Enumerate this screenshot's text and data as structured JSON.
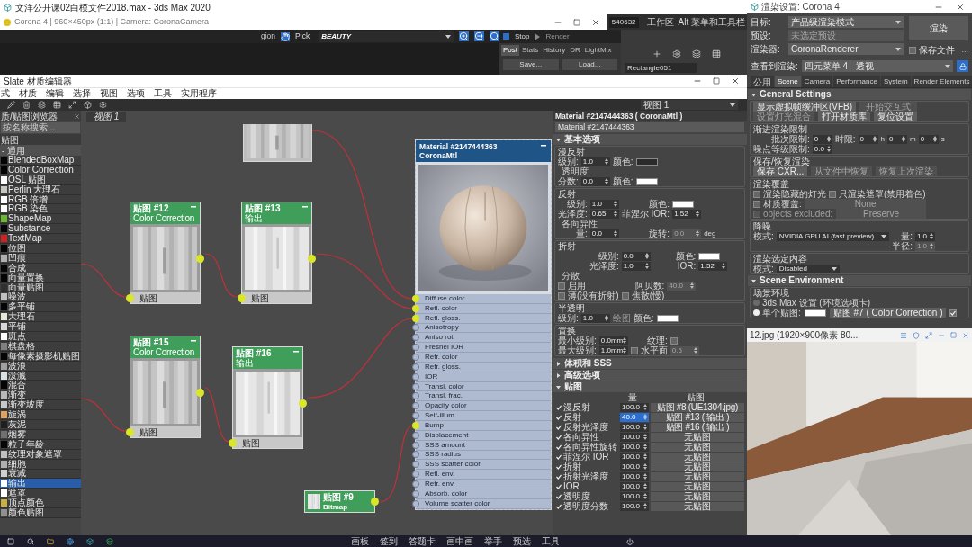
{
  "max_window": {
    "title": "文洋公开课02白模文件2018.max - 3ds Max 2020"
  },
  "vfb": {
    "title": "Corona 4 | 960×450px (1:1) | Camera: CoronaCamera",
    "region": "gion",
    "pick": "Pick",
    "channel": "BEAUTY",
    "stop": "Stop",
    "render": "Render",
    "tabs": [
      {
        "label": "Post",
        "selected": true
      },
      {
        "label": "Stats",
        "selected": false
      },
      {
        "label": "History",
        "selected": false
      },
      {
        "label": "DR",
        "selected": false
      },
      {
        "label": "LightMix",
        "selected": false
      }
    ],
    "buttons": [
      "Save...",
      "Load..."
    ]
  },
  "max_toolbar": {
    "value": "540632",
    "workspace": "工作区",
    "menu": "Alt 菜单和工具栏",
    "object": "Rectangle051"
  },
  "slate": {
    "title": "Slate 材质编辑器",
    "menu": [
      "式",
      "材质",
      "编辑",
      "选择",
      "视图",
      "选项",
      "工具",
      "实用程序"
    ],
    "view_dropdown": "视图 1",
    "view_tab": "视图 1",
    "browser": {
      "title": "质/贴图浏览器",
      "search": "按名称搜索...",
      "section": "贴图",
      "group": "- 通用",
      "items": [
        {
          "label": "BlendedBoxMap",
          "color": "#050505",
          "selected": false
        },
        {
          "label": "Color Correction",
          "color": "#050505",
          "selected": false
        },
        {
          "label": "OSL 贴图",
          "color": "#ffffff",
          "selected": false
        },
        {
          "label": "Perlin 大理石",
          "color": "#c8c8c0",
          "selected": false
        },
        {
          "label": "RGB 倍增",
          "color": "#ffffff",
          "selected": false
        },
        {
          "label": "RGB 染色",
          "color": "#ffffff",
          "selected": false
        },
        {
          "label": "ShapeMap",
          "color": "#6ab82e",
          "selected": false
        },
        {
          "label": "Substance",
          "color": "#050505",
          "selected": false
        },
        {
          "label": "TextMap",
          "color": "#d42020",
          "selected": false
        },
        {
          "label": "位图",
          "color": "#050505",
          "selected": false
        },
        {
          "label": "凹痕",
          "color": "#b0b0b0",
          "selected": false
        },
        {
          "label": "合成",
          "color": "#050505",
          "selected": false
        },
        {
          "label": "向量置换",
          "color": "#050505",
          "selected": false
        },
        {
          "label": "向量贴图",
          "color": "#303030",
          "selected": false
        },
        {
          "label": "噪波",
          "color": "#c0c0c0",
          "selected": false
        },
        {
          "label": "多平铺",
          "color": "#050505",
          "selected": false
        },
        {
          "label": "大理石",
          "color": "#e8e8d8",
          "selected": false
        },
        {
          "label": "平铺",
          "color": "#d8d8d8",
          "selected": false
        },
        {
          "label": "斑点",
          "color": "#ffffff",
          "selected": false
        },
        {
          "label": "棋盘格",
          "color": "#808080",
          "selected": false
        },
        {
          "label": "每像素摄影机贴图",
          "color": "#050505",
          "selected": false
        },
        {
          "label": "波浪",
          "color": "#a0a0a0",
          "selected": false
        },
        {
          "label": "泼溅",
          "color": "#d8e0e8",
          "selected": false
        },
        {
          "label": "混合",
          "color": "#050505",
          "selected": false
        },
        {
          "label": "渐变",
          "color": "#b8b8b8",
          "selected": false
        },
        {
          "label": "渐变坡度",
          "color": "#c8c8c8",
          "selected": false
        },
        {
          "label": "旋涡",
          "color": "#e0a060",
          "selected": false
        },
        {
          "label": "灰泥",
          "color": "#202020",
          "selected": false
        },
        {
          "label": "烟雾",
          "color": "#707070",
          "selected": false
        },
        {
          "label": "粒子年龄",
          "color": "#050505",
          "selected": false
        },
        {
          "label": "纹理对象遮罩",
          "color": "#c0c0c0",
          "selected": false
        },
        {
          "label": "细胞",
          "color": "#b0b0b0",
          "selected": false
        },
        {
          "label": "衰减",
          "color": "#d0d0d0",
          "selected": false
        },
        {
          "label": "输出",
          "color": "#ffffff",
          "selected": true
        },
        {
          "label": "遮罩",
          "color": "#ffffff",
          "selected": false
        },
        {
          "label": "顶点颜色",
          "color": "#c8b040",
          "selected": false
        },
        {
          "label": "颜色贴图",
          "color": "#909090",
          "selected": false
        }
      ]
    },
    "nodes": [
      {
        "kind": "full",
        "title": "贴图 #12",
        "type": "Color Correction",
        "port": "贴图"
      },
      {
        "kind": "full",
        "title": "贴图 #13",
        "type": "输出",
        "port": "贴图"
      },
      {
        "kind": "full",
        "title": "贴图 #15",
        "type": "Color Correction",
        "port": "贴图"
      },
      {
        "kind": "full",
        "title": "贴图 #16",
        "type": "输出",
        "port": "贴图"
      },
      {
        "kind": "compact",
        "title": "贴图 #9",
        "type": "Bitmap"
      }
    ],
    "material_node": {
      "title": "Material #2147444363",
      "type": "CoronaMtl",
      "slots": [
        {
          "label": "Diffuse color",
          "connected": true
        },
        {
          "label": "Refl. color",
          "connected": true
        },
        {
          "label": "Refl. gloss.",
          "connected": true
        },
        {
          "label": "Anisotropy",
          "connected": false
        },
        {
          "label": "Aniso rot.",
          "connected": false
        },
        {
          "label": "Fresnel IOR",
          "connected": false
        },
        {
          "label": "Refr. color",
          "connected": false
        },
        {
          "label": "Refr. gloss.",
          "connected": false
        },
        {
          "label": "IOR",
          "connected": false
        },
        {
          "label": "Transl. color",
          "connected": false
        },
        {
          "label": "Transl. frac.",
          "connected": false
        },
        {
          "label": "Opacity color",
          "connected": false
        },
        {
          "label": "Self-illum.",
          "connected": false
        },
        {
          "label": "Bump",
          "connected": true
        },
        {
          "label": "Displacement",
          "connected": false
        },
        {
          "label": "SSS amount",
          "connected": false
        },
        {
          "label": "SSS radius",
          "connected": false
        },
        {
          "label": "SSS scatter color",
          "connected": false
        },
        {
          "label": "Refl. env.",
          "connected": false
        },
        {
          "label": "Refr. env.",
          "connected": false
        },
        {
          "label": "Absorb. color",
          "connected": false
        },
        {
          "label": "Volume scatter color",
          "connected": false
        }
      ]
    },
    "params": {
      "title": "Material #2147444363 ( CoronaMtl )",
      "name": "Material #2147444363",
      "rollouts": [
        {
          "title": "基本选项",
          "expanded": true,
          "groups": [
            {
              "title": "漫反射",
              "rows": [
                {
                  "kind": "fields",
                  "cells": [
                    {
                      "kind": "label",
                      "text": "级别:"
                    },
                    {
                      "kind": "spinner",
                      "value": "1.0",
                      "disabled": false
                    },
                    {
                      "kind": "label",
                      "text": "颜色:"
                    },
                    {
                      "kind": "swatch",
                      "color": "#2b2b2b"
                    }
                  ]
                },
                {
                  "kind": "heading",
                  "text": "透明度"
                },
                {
                  "kind": "fields",
                  "cells": [
                    {
                      "kind": "label",
                      "text": "分数:"
                    },
                    {
                      "kind": "spinner",
                      "value": "0.0",
                      "disabled": false
                    },
                    {
                      "kind": "label",
                      "text": "颜色:"
                    },
                    {
                      "kind": "swatch",
                      "color": "#ffffff"
                    }
                  ]
                }
              ]
            },
            {
              "title": "反射",
              "rows": [
                {
                  "kind": "fields",
                  "cells": [
                    {
                      "kind": "label",
                      "text": "级别:"
                    },
                    {
                      "kind": "spinner",
                      "value": "1.0",
                      "disabled": false
                    },
                    {
                      "kind": "label",
                      "text": "颜色:"
                    },
                    {
                      "kind": "swatch",
                      "color": "#ffffff"
                    }
                  ]
                },
                {
                  "kind": "fields",
                  "cells": [
                    {
                      "kind": "label",
                      "text": "光泽度:"
                    },
                    {
                      "kind": "spinner",
                      "value": "0.65",
                      "disabled": false
                    },
                    {
                      "kind": "label",
                      "text": "菲涅尔 IOR:"
                    },
                    {
                      "kind": "spinner",
                      "value": "1.52",
                      "disabled": false
                    }
                  ]
                },
                {
                  "kind": "heading",
                  "text": "各向异性"
                },
                {
                  "kind": "fields",
                  "cells": [
                    {
                      "kind": "label",
                      "text": "量:"
                    },
                    {
                      "kind": "spinner",
                      "value": "0.0",
                      "disabled": false
                    },
                    {
                      "kind": "label",
                      "text": "旋转:"
                    },
                    {
                      "kind": "spinner",
                      "value": "0.0",
                      "disabled": true
                    },
                    {
                      "kind": "text",
                      "text": "deg"
                    }
                  ]
                }
              ]
            },
            {
              "title": "折射",
              "rows": [
                {
                  "kind": "fields",
                  "cells": [
                    {
                      "kind": "label",
                      "text": "级别:"
                    },
                    {
                      "kind": "spinner",
                      "value": "0.0",
                      "disabled": false
                    },
                    {
                      "kind": "label",
                      "text": "颜色:"
                    },
                    {
                      "kind": "swatch",
                      "color": "#ffffff"
                    }
                  ]
                },
                {
                  "kind": "fields",
                  "cells": [
                    {
                      "kind": "label",
                      "text": "光泽度:"
                    },
                    {
                      "kind": "spinner",
                      "value": "1.0",
                      "disabled": false
                    },
                    {
                      "kind": "label",
                      "text": "IOR:"
                    },
                    {
                      "kind": "spinner",
                      "value": "1.52",
                      "disabled": false
                    }
                  ]
                },
                {
                  "kind": "heading",
                  "text": "分散"
                },
                {
                  "kind": "fields",
                  "cells": [
                    {
                      "kind": "check",
                      "text": "启用",
                      "checked": false,
                      "disabled": false
                    },
                    {
                      "kind": "label",
                      "text": "阿贝数:"
                    },
                    {
                      "kind": "spinner",
                      "value": "40.0",
                      "disabled": true
                    }
                  ]
                },
                {
                  "kind": "fields",
                  "cells": [
                    {
                      "kind": "check",
                      "text": "薄(没有折射)",
                      "checked": false,
                      "disabled": false
                    },
                    {
                      "kind": "check",
                      "text": "焦散(慢)",
                      "checked": false,
                      "disabled": false
                    }
                  ]
                }
              ]
            },
            {
              "title": "半透明",
              "rows": [
                {
                  "kind": "fields",
                  "cells": [
                    {
                      "kind": "label",
                      "text": "级别:"
                    },
                    {
                      "kind": "spinner",
                      "value": "1.0",
                      "disabled": false
                    },
                    {
                      "kind": "note",
                      "text": "绘图"
                    },
                    {
                      "kind": "label",
                      "text": "颜色:"
                    },
                    {
                      "kind": "swatch",
                      "color": "#ffffff"
                    }
                  ]
                }
              ]
            },
            {
              "title": "置换",
              "rows": [
                {
                  "kind": "fields",
                  "cells": [
                    {
                      "kind": "label",
                      "text": "最小级别:"
                    },
                    {
                      "kind": "spinner",
                      "value": "0.0mm",
                      "disabled": false
                    },
                    {
                      "kind": "label",
                      "text": "纹理:"
                    },
                    {
                      "kind": "check",
                      "checked": false,
                      "disabled": false
                    }
                  ]
                },
                {
                  "kind": "fields",
                  "cells": [
                    {
                      "kind": "label",
                      "text": "最大级别:"
                    },
                    {
                      "kind": "spinner",
                      "value": "1.0mm",
                      "disabled": false
                    },
                    {
                      "kind": "check",
                      "text": "水平面",
                      "checked": false,
                      "disabled": false
                    },
                    {
                      "kind": "spinner",
                      "value": "0.5",
                      "disabled": true
                    }
                  ]
                }
              ]
            }
          ]
        },
        {
          "title": "体积和 SSS",
          "expanded": false
        },
        {
          "title": "高级选项",
          "expanded": false
        },
        {
          "title": "贴图",
          "expanded": true,
          "maps": {
            "amount_header": "量",
            "map_header": "贴图",
            "rows": [
              {
                "checked": true,
                "label": "漫反射",
                "amount": "100.0",
                "focused": false,
                "map": "贴图 #8 (UE1304.jpg)"
              },
              {
                "checked": true,
                "label": "反射",
                "amount": "40.0",
                "focused": true,
                "map": "贴图 #13 ( 输出 )"
              },
              {
                "checked": true,
                "label": "反射光泽度",
                "amount": "100.0",
                "focused": false,
                "map": "贴图 #16 ( 输出 )"
              },
              {
                "checked": true,
                "label": "各向异性",
                "amount": "100.0",
                "focused": false,
                "map": "无贴图"
              },
              {
                "checked": true,
                "label": "各向异性旋转",
                "amount": "100.0",
                "focused": false,
                "map": "无贴图"
              },
              {
                "checked": true,
                "label": "菲涅尔 IOR",
                "amount": "100.0",
                "focused": false,
                "map": "无贴图"
              },
              {
                "checked": true,
                "label": "折射",
                "amount": "100.0",
                "focused": false,
                "map": "无贴图"
              },
              {
                "checked": true,
                "label": "折射光泽度",
                "amount": "100.0",
                "focused": false,
                "map": "无贴图"
              },
              {
                "checked": true,
                "label": "IOR",
                "amount": "100.0",
                "focused": false,
                "map": "无贴图"
              },
              {
                "checked": true,
                "label": "透明度",
                "amount": "100.0",
                "focused": false,
                "map": "无贴图"
              },
              {
                "checked": true,
                "label": "透明度分数",
                "amount": "100.0",
                "focused": false,
                "map": "无贴图"
              }
            ]
          }
        }
      ]
    }
  },
  "render_setup": {
    "title": "渲染设置: Corona 4",
    "fields": [
      {
        "label": "目标:",
        "value": "产品级渲染模式",
        "disabled": false
      },
      {
        "label": "预设:",
        "value": "未选定预设",
        "disabled": true
      },
      {
        "label": "渲染器:",
        "value": "CoronaRenderer",
        "disabled": false
      }
    ],
    "view": {
      "label": "查看到渲染:",
      "value": "四元菜单 4 - 透视"
    },
    "render_button": "渲染",
    "save_file": {
      "label": "保存文件",
      "checked": false
    },
    "more": "...",
    "tabs": [
      {
        "label": "公用",
        "selected": false
      },
      {
        "label": "Scene",
        "selected": true
      },
      {
        "label": "Camera",
        "selected": false
      },
      {
        "label": "Performance",
        "selected": false
      },
      {
        "label": "System",
        "selected": false
      },
      {
        "label": "Render Elements",
        "selected": false
      }
    ],
    "rollouts": [
      {
        "title": "General Settings",
        "expanded": true,
        "groups": [
          {
            "rows": [
              {
                "kind": "buttons",
                "items": [
                  {
                    "text": "显示虚拟帧缓冲区(VFB)",
                    "disabled": false
                  },
                  {
                    "text": "开始交互式",
                    "disabled": true
                  }
                ]
              },
              {
                "kind": "buttons",
                "items": [
                  {
                    "text": "设置灯光混合",
                    "disabled": true
                  },
                  {
                    "text": "打开材质库",
                    "disabled": false
                  },
                  {
                    "text": "复位设置",
                    "disabled": false
                  }
                ]
              }
            ]
          },
          {
            "title": "渐进渲染限制",
            "rows": [
              {
                "kind": "fields",
                "cells": [
                  {
                    "kind": "label",
                    "text": "批次限制:"
                  },
                  {
                    "kind": "spinner",
                    "value": "0",
                    "disabled": false
                  },
                  {
                    "kind": "label",
                    "text": "时限:"
                  },
                  {
                    "kind": "spinner",
                    "value": "0",
                    "disabled": false
                  },
                  {
                    "kind": "text",
                    "text": "h"
                  },
                  {
                    "kind": "spinner",
                    "value": "0",
                    "disabled": false
                  },
                  {
                    "kind": "text",
                    "text": "m"
                  },
                  {
                    "kind": "spinner",
                    "value": "0",
                    "disabled": false
                  },
                  {
                    "kind": "text",
                    "text": "s"
                  }
                ]
              },
              {
                "kind": "fields",
                "cells": [
                  {
                    "kind": "label",
                    "text": "噪点等级限制:"
                  },
                  {
                    "kind": "spinner",
                    "value": "0.0",
                    "disabled": false
                  }
                ]
              }
            ]
          },
          {
            "title": "保存/恢复渲染",
            "rows": [
              {
                "kind": "buttons",
                "items": [
                  {
                    "text": "保存 CXR...",
                    "disabled": false
                  },
                  {
                    "text": "从文件中恢复",
                    "disabled": true
                  },
                  {
                    "text": "恢复上次渲染",
                    "disabled": true
                  }
                ]
              }
            ]
          },
          {
            "title": "渲染覆盖",
            "rows": [
              {
                "kind": "fields",
                "cells": [
                  {
                    "kind": "check",
                    "text": "渲染隐藏的灯光",
                    "checked": false,
                    "disabled": false
                  },
                  {
                    "kind": "check",
                    "text": "只渲染遮罩(禁用着色)",
                    "checked": false,
                    "disabled": false
                  }
                ]
              },
              {
                "kind": "fields",
                "cells": [
                  {
                    "kind": "check",
                    "text": "材质覆盖:",
                    "checked": false,
                    "disabled": false
                  },
                  {
                    "kind": "button",
                    "text": "None",
                    "disabled": true
                  }
                ]
              },
              {
                "kind": "fields",
                "cells": [
                  {
                    "kind": "check",
                    "text": "objects excluded:",
                    "checked": false,
                    "disabled": true
                  },
                  {
                    "kind": "button",
                    "text": "Preserve",
                    "disabled": true
                  }
                ]
              }
            ]
          },
          {
            "title": "降噪",
            "rows": [
              {
                "kind": "fields",
                "cells": [
                  {
                    "kind": "label",
                    "text": "模式:"
                  },
                  {
                    "kind": "dropdown",
                    "value": "NVIDIA GPU AI (fast preview)",
                    "disabled": false
                  },
                  {
                    "kind": "label",
                    "text": "量:"
                  },
                  {
                    "kind": "spinner",
                    "value": "1.0",
                    "disabled": false
                  }
                ]
              },
              {
                "kind": "fields",
                "cells": [
                  {
                    "kind": "gap"
                  },
                  {
                    "kind": "gap"
                  },
                  {
                    "kind": "label",
                    "text": "半径:"
                  },
                  {
                    "kind": "spinner",
                    "value": "1.0",
                    "disabled": true
                  }
                ]
              }
            ]
          },
          {
            "title": "渲染选定内容",
            "rows": [
              {
                "kind": "fields",
                "cells": [
                  {
                    "kind": "label",
                    "text": "模式:"
                  },
                  {
                    "kind": "dropdown",
                    "value": "Disabled",
                    "disabled": false
                  }
                ]
              }
            ]
          }
        ]
      },
      {
        "title": "Scene Environment",
        "expanded": true,
        "groups": [
          {
            "title": "场景环境",
            "rows": [
              {
                "kind": "fields",
                "cells": [
                  {
                    "kind": "radio",
                    "text": "3ds Max 设置 (环境选项卡)",
                    "selected": false
                  }
                ]
              },
              {
                "kind": "fields",
                "cells": [
                  {
                    "kind": "radio",
                    "text": "单个贴图:",
                    "selected": true
                  },
                  {
                    "kind": "swatch",
                    "color": "#ffffff"
                  },
                  {
                    "kind": "button",
                    "text": "贴图 #7 ( Color Correction )",
                    "disabled": false
                  },
                  {
                    "kind": "check",
                    "checked": true,
                    "disabled": false
                  }
                ]
              }
            ]
          }
        ]
      }
    ]
  },
  "image_viewer": {
    "title": "12.jpg (1920×900像素 80..."
  },
  "taskbar": {
    "items": [
      "画板",
      "签到",
      "答题卡",
      "画中画",
      "举手",
      "预选",
      "工具"
    ]
  }
}
